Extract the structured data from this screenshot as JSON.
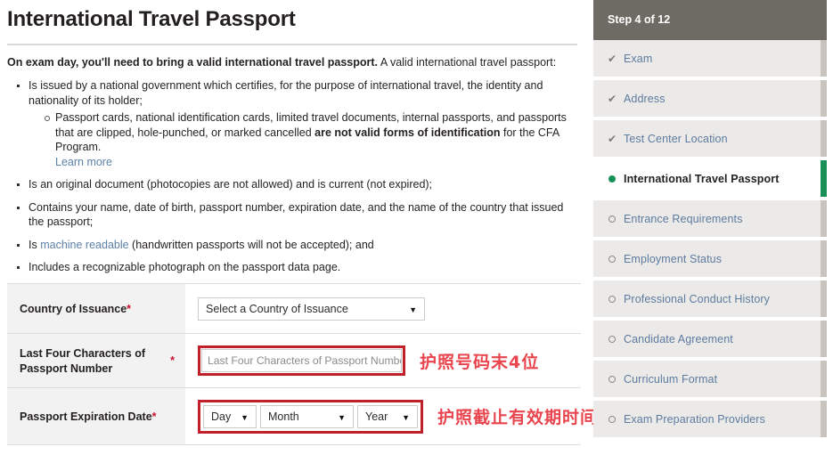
{
  "main": {
    "title": "International Travel Passport",
    "intro_bold": "On exam day, you'll need to bring a valid international travel passport.",
    "intro_rest": " A valid international travel passport:",
    "bullets": [
      {
        "text": "Is issued by a national government which certifies, for the purpose of international travel, the identity and nationality of its holder;",
        "sub": {
          "lead": "Passport cards, national identification cards, limited travel documents, internal passports, and passports that are clipped, hole-punched, or marked cancelled ",
          "bold": "are not valid forms of identification",
          "tail": " for the CFA Program.",
          "link": "Learn more"
        }
      },
      {
        "text": "Is an original document (photocopies are not allowed) and is current (not expired);"
      },
      {
        "text": "Contains your name, date of birth, passport number, expiration date, and the name of the country that issued the passport;"
      },
      {
        "lead": "Is ",
        "link": "machine readable",
        "tail": " (handwritten passports will not be accepted); and"
      },
      {
        "text": "Includes a recognizable photograph on the passport data page."
      }
    ],
    "form": {
      "required_marker": "*",
      "rows": [
        {
          "label": "Country of Issuance",
          "control": "country-select",
          "select_value": "Select a Country of Issuance"
        },
        {
          "label": "Last Four Characters of Passport Number",
          "control": "passport-last-four-input",
          "input_value": "",
          "input_placeholder": "Last Four Characters of Passport Number",
          "annotation": "护照号码末4位"
        },
        {
          "label": "Passport Expiration Date",
          "control": "expiration-date-selects",
          "day_value": "Day",
          "month_value": "Month",
          "year_value": "Year",
          "annotation": "护照截止有效期时间"
        }
      ]
    }
  },
  "sidebar": {
    "step_label": "Step 4 of 12",
    "items": [
      {
        "label": "Exam",
        "state": "complete"
      },
      {
        "label": "Address",
        "state": "complete"
      },
      {
        "label": "Test Center Location",
        "state": "complete"
      },
      {
        "label": "International Travel Passport",
        "state": "active"
      },
      {
        "label": "Entrance Requirements",
        "state": "pending"
      },
      {
        "label": "Employment Status",
        "state": "pending"
      },
      {
        "label": "Professional Conduct History",
        "state": "pending"
      },
      {
        "label": "Candidate Agreement",
        "state": "pending"
      },
      {
        "label": "Curriculum Format",
        "state": "pending"
      },
      {
        "label": "Exam Preparation Providers",
        "state": "pending"
      }
    ]
  },
  "colors": {
    "accent_green": "#1a9059",
    "header_gray": "#6e6b64",
    "link_blue": "#5d81a8",
    "annotation_red": "#e8454f",
    "highlight_box_red": "#c0202a",
    "required_star_red": "#c8102e"
  },
  "icons": {
    "check": "check-icon",
    "active_dot": "active-dot-icon",
    "pending_ring": "pending-circle-icon",
    "caret": "chevron-down-icon"
  },
  "glyphs": {
    "check": "✔",
    "caret": "▼"
  }
}
